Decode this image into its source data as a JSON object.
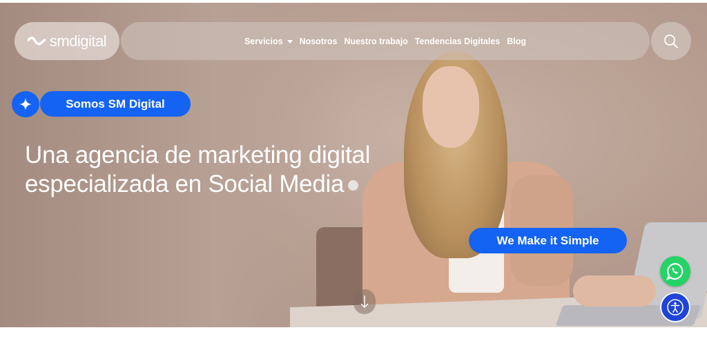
{
  "brand": {
    "logo_text": "smdigital"
  },
  "nav": {
    "items": [
      {
        "label": "Servicios",
        "has_dropdown": true
      },
      {
        "label": "Nosotros"
      },
      {
        "label": "Nuestro trabajo"
      },
      {
        "label": "Tendencias Digitales"
      },
      {
        "label": "Blog"
      }
    ],
    "search_icon": "search-icon"
  },
  "hero": {
    "badge_label": "Somos SM Digital",
    "badge_icon": "sparkle-icon",
    "headline_line1": "Una agencia de marketing digital",
    "headline_line2": "especializada en Social Media",
    "tagline_button": "We Make it Simple",
    "scroll_icon": "arrow-down-icon"
  },
  "floating": {
    "whatsapp_icon": "whatsapp-icon",
    "accessibility_icon": "accessibility-icon"
  },
  "colors": {
    "accent": "#1463f3",
    "whatsapp": "#25d366",
    "accessibility": "#1f44d6"
  }
}
